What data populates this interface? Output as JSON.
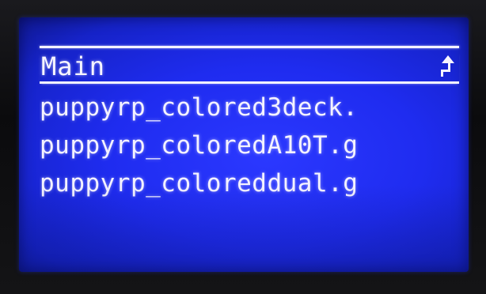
{
  "header": {
    "title": "Main",
    "back_icon": "up-arrow-icon"
  },
  "files": [
    {
      "label": "puppyrp_colored3deck."
    },
    {
      "label": "puppyrp_coloredA10T.g"
    },
    {
      "label": "puppyrp_coloreddual.g"
    }
  ],
  "colors": {
    "lcd_background": "#1f2cf0",
    "text": "#f4f2ff"
  }
}
